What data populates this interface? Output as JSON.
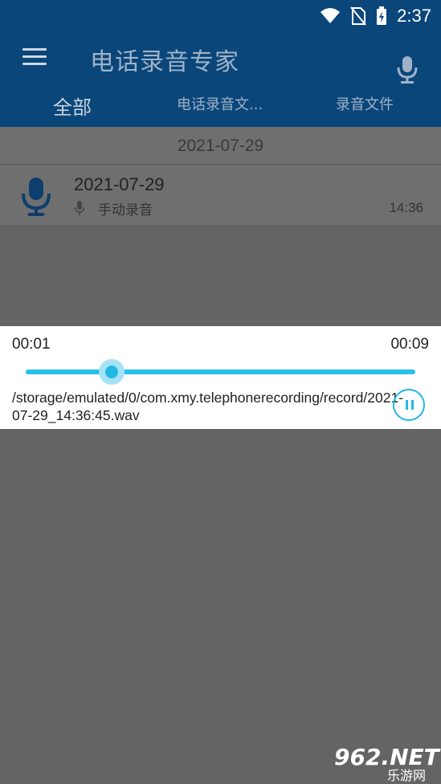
{
  "status_bar": {
    "time": "2:37"
  },
  "header": {
    "title": "电话录音专家"
  },
  "tabs": [
    {
      "label": "全部",
      "active": true
    },
    {
      "label": "电话录音文..."
    },
    {
      "label": "录音文件"
    }
  ],
  "list": {
    "date_header": "2021-07-29",
    "items": [
      {
        "title": "2021-07-29",
        "subtitle": "手动录音",
        "time": "14:36"
      }
    ]
  },
  "player": {
    "current_time": "00:01",
    "total_time": "00:09",
    "progress": 0.22,
    "file_path": "/storage/emulated/0/com.xmy.telephonerecording/record/2021-07-29_14:36:45.wav"
  },
  "watermark": {
    "text": "962.NET",
    "sub": "乐游网"
  },
  "colors": {
    "appbar": "#0a467a",
    "accent": "#26c0ec",
    "overlay": "#646464"
  }
}
